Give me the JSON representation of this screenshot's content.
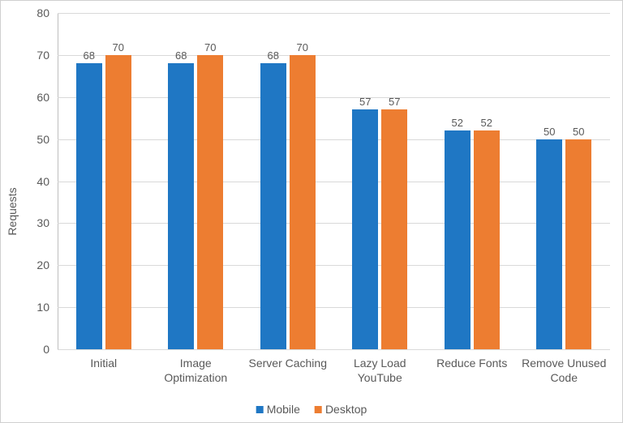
{
  "chart_data": {
    "type": "bar",
    "ylabel": "Requests",
    "xlabel": "",
    "title": "",
    "ylim": [
      0,
      80
    ],
    "ytick_step": 10,
    "categories": [
      "Initial",
      "Image Optimization",
      "Server Caching",
      "Lazy Load YouTube",
      "Reduce Fonts",
      "Remove Unused Code"
    ],
    "series": [
      {
        "name": "Mobile",
        "color": "#1f77c4",
        "values": [
          68,
          68,
          68,
          57,
          52,
          50
        ]
      },
      {
        "name": "Desktop",
        "color": "#ed7d31",
        "values": [
          70,
          70,
          70,
          57,
          52,
          50
        ]
      }
    ],
    "legend_position": "bottom"
  }
}
